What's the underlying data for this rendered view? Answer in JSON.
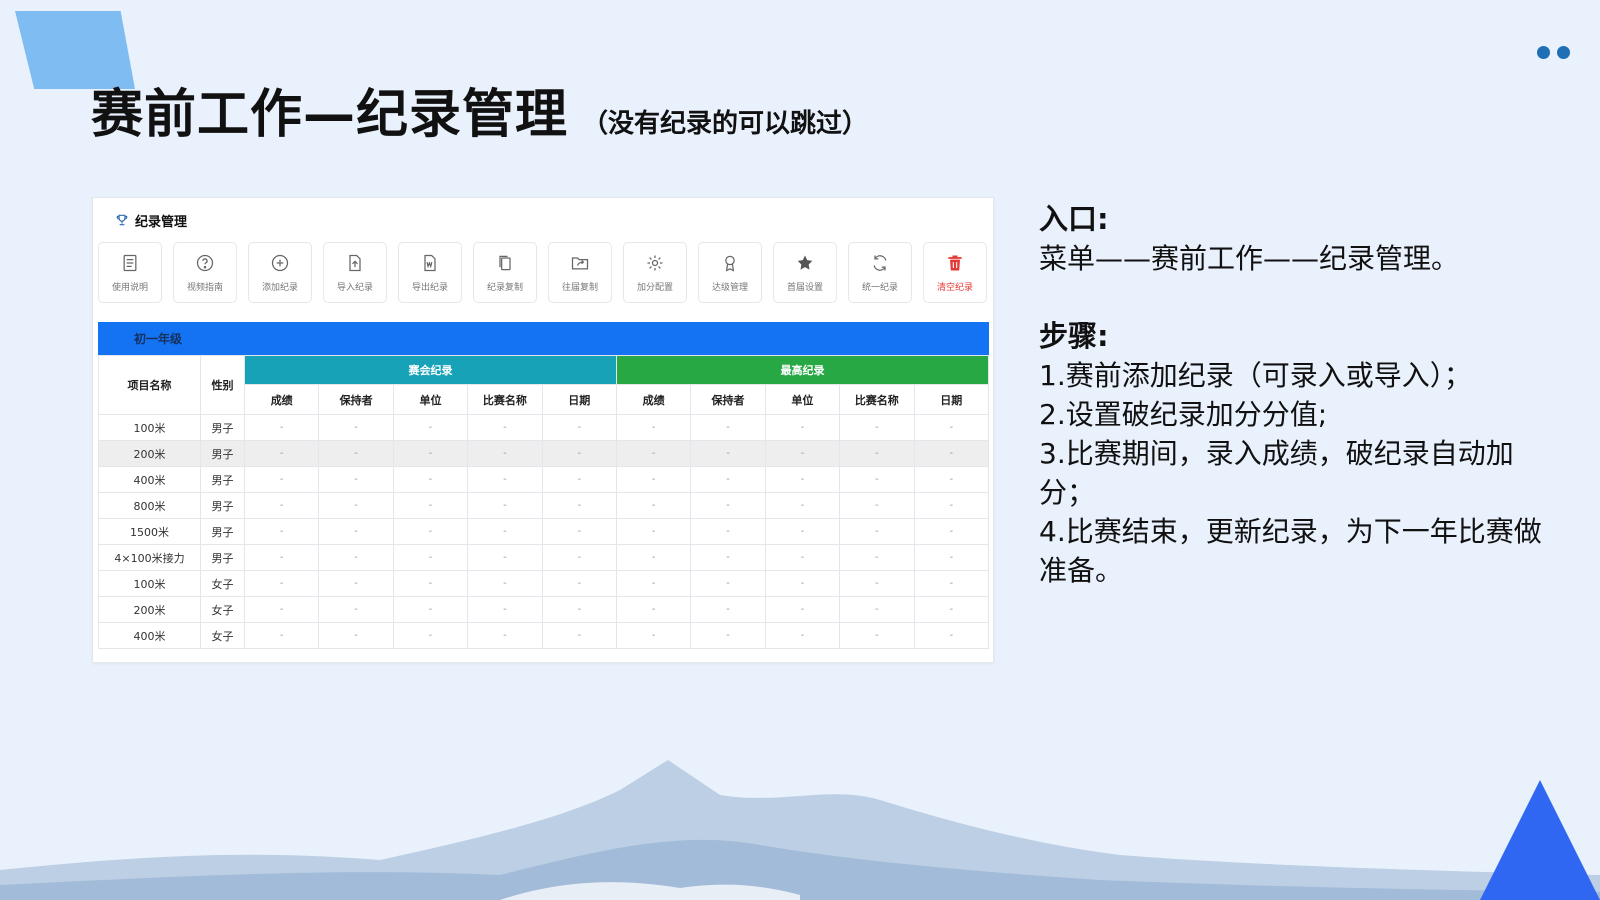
{
  "slide": {
    "title": "赛前工作—纪录管理",
    "subtitle": "（没有纪录的可以跳过）"
  },
  "panel": {
    "header": "纪录管理",
    "toolbar": [
      {
        "label": "使用说明",
        "icon": "document-list-icon"
      },
      {
        "label": "视频指南",
        "icon": "question-circle-icon"
      },
      {
        "label": "添加纪录",
        "icon": "plus-circle-icon"
      },
      {
        "label": "导入纪录",
        "icon": "file-upload-icon"
      },
      {
        "label": "导出纪录",
        "icon": "word-file-icon"
      },
      {
        "label": "纪录复制",
        "icon": "copy-icon"
      },
      {
        "label": "往届复制",
        "icon": "folder-share-icon"
      },
      {
        "label": "加分配置",
        "icon": "gear-icon"
      },
      {
        "label": "达级管理",
        "icon": "award-icon"
      },
      {
        "label": "首届设置",
        "icon": "star-icon"
      },
      {
        "label": "统一纪录",
        "icon": "refresh-icon"
      },
      {
        "label": "清空纪录",
        "icon": "trash-icon"
      }
    ],
    "grade": "初一年级",
    "table": {
      "col_event": "项目名称",
      "col_gender": "性别",
      "group1": "赛会纪录",
      "group2": "最高纪录",
      "subcols": [
        "成绩",
        "保持者",
        "单位",
        "比赛名称",
        "日期",
        "成绩",
        "保持者",
        "单位",
        "比赛名称",
        "日期"
      ],
      "rows": [
        {
          "event": "100米",
          "gender": "男子",
          "cells": [
            "-",
            "-",
            "-",
            "-",
            "-",
            "-",
            "-",
            "-",
            "-",
            "-"
          ]
        },
        {
          "event": "200米",
          "gender": "男子",
          "cells": [
            "-",
            "-",
            "-",
            "-",
            "-",
            "-",
            "-",
            "-",
            "-",
            "-"
          ]
        },
        {
          "event": "400米",
          "gender": "男子",
          "cells": [
            "-",
            "-",
            "-",
            "-",
            "-",
            "-",
            "-",
            "-",
            "-",
            "-"
          ]
        },
        {
          "event": "800米",
          "gender": "男子",
          "cells": [
            "-",
            "-",
            "-",
            "-",
            "-",
            "-",
            "-",
            "-",
            "-",
            "-"
          ]
        },
        {
          "event": "1500米",
          "gender": "男子",
          "cells": [
            "-",
            "-",
            "-",
            "-",
            "-",
            "-",
            "-",
            "-",
            "-",
            "-"
          ]
        },
        {
          "event": "4×100米接力",
          "gender": "男子",
          "cells": [
            "-",
            "-",
            "-",
            "-",
            "-",
            "-",
            "-",
            "-",
            "-",
            "-"
          ]
        },
        {
          "event": "100米",
          "gender": "女子",
          "cells": [
            "-",
            "-",
            "-",
            "-",
            "-",
            "-",
            "-",
            "-",
            "-",
            "-"
          ]
        },
        {
          "event": "200米",
          "gender": "女子",
          "cells": [
            "-",
            "-",
            "-",
            "-",
            "-",
            "-",
            "-",
            "-",
            "-",
            "-"
          ]
        },
        {
          "event": "400米",
          "gender": "女子",
          "cells": [
            "-",
            "-",
            "-",
            "-",
            "-",
            "-",
            "-",
            "-",
            "-",
            "-"
          ]
        }
      ]
    }
  },
  "notes": {
    "entry_heading": "入口:",
    "entry_text": "菜单——赛前工作——纪录管理。",
    "steps_heading": "步骤:",
    "steps": [
      "1.赛前添加纪录（可录入或导入）；",
      "2.设置破纪录加分分值;",
      "3.比赛期间，录入成绩，破纪录自动加分；",
      "4.比赛结束，更新纪录，为下一年比赛做准备。"
    ]
  },
  "colors": {
    "background": "#e9f1fc",
    "grade_bar": "#1473f3",
    "group_teal": "#17a2b8",
    "group_green": "#28a745",
    "danger": "#e53935",
    "triangle": "#2f66f2"
  }
}
